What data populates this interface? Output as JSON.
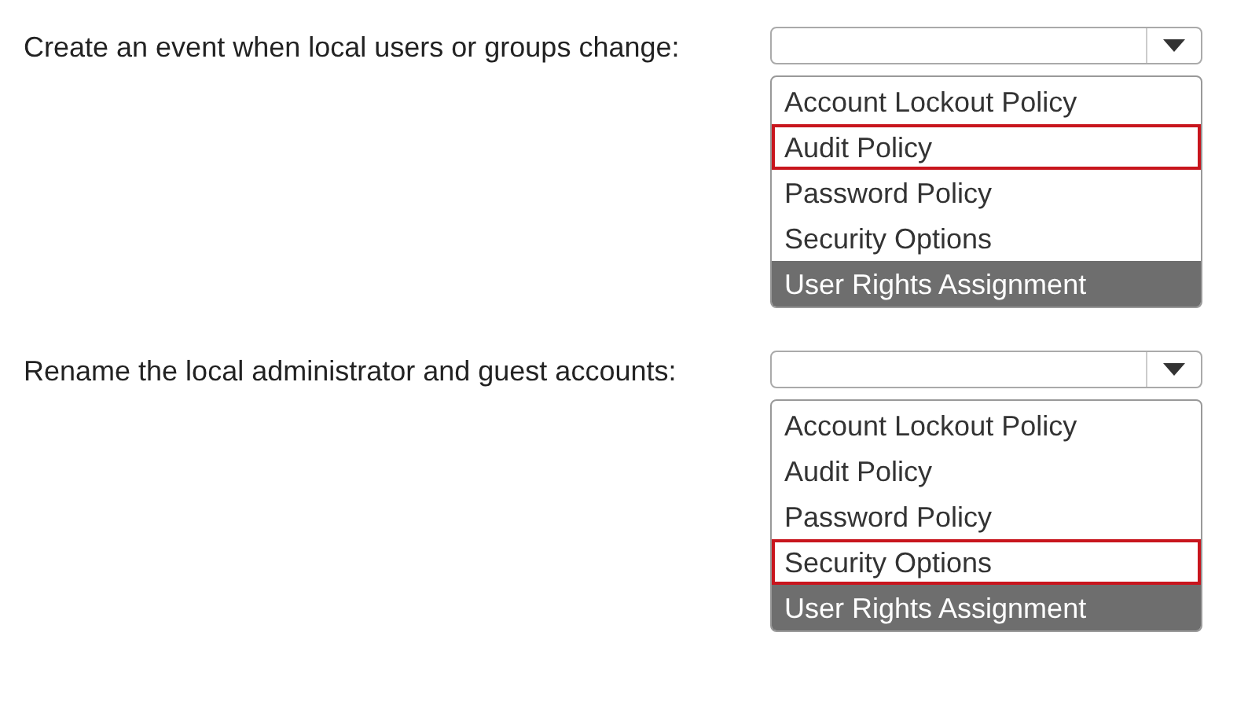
{
  "questions": [
    {
      "prompt": "Create an event when local users or groups change:",
      "options": [
        {
          "label": "Account Lockout Policy",
          "selected": false,
          "highlighted": false
        },
        {
          "label": "Audit Policy",
          "selected": true,
          "highlighted": false
        },
        {
          "label": "Password Policy",
          "selected": false,
          "highlighted": false
        },
        {
          "label": "Security Options",
          "selected": false,
          "highlighted": false
        },
        {
          "label": "User Rights Assignment",
          "selected": false,
          "highlighted": true
        }
      ]
    },
    {
      "prompt": "Rename the local administrator and guest accounts:",
      "options": [
        {
          "label": "Account Lockout Policy",
          "selected": false,
          "highlighted": false
        },
        {
          "label": "Audit Policy",
          "selected": false,
          "highlighted": false
        },
        {
          "label": "Password Policy",
          "selected": false,
          "highlighted": false
        },
        {
          "label": "Security Options",
          "selected": true,
          "highlighted": false
        },
        {
          "label": "User Rights Assignment",
          "selected": false,
          "highlighted": true
        }
      ]
    }
  ]
}
